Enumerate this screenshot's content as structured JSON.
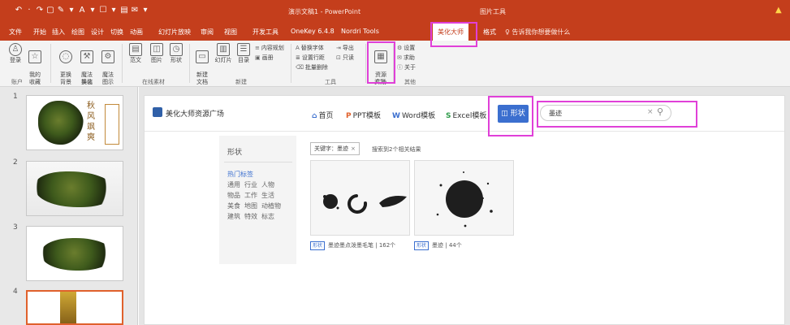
{
  "titlebar": {
    "doc_title": "演示文稿1 - PowerPoint",
    "context_title": "图片工具",
    "qat": [
      "↶",
      "·",
      "↷",
      "▢",
      "✎",
      "▾",
      "A",
      "▾",
      "☐",
      "▾",
      "▤",
      "✉",
      "▾"
    ]
  },
  "tabs": {
    "items": [
      {
        "label": "文件"
      },
      {
        "label": "开始"
      },
      {
        "label": "插入"
      },
      {
        "label": "绘图"
      },
      {
        "label": "设计"
      },
      {
        "label": "切换"
      },
      {
        "label": "动画"
      },
      {
        "label": "幻灯片放映"
      },
      {
        "label": "审阅"
      },
      {
        "label": "视图"
      },
      {
        "label": "开发工具"
      },
      {
        "label": "OneKey 6.4.8"
      },
      {
        "label": "Nordri Tools"
      },
      {
        "label": "美化大师"
      },
      {
        "label": "格式"
      }
    ],
    "search": "告诉我你想要做什么",
    "search_icon": "♀"
  },
  "ribbon": {
    "buttons": [
      {
        "label": "登录",
        "icon": "♙"
      },
      {
        "label": "我的\n收藏",
        "icon": "☆"
      },
      {
        "label": "更换\n背景",
        "icon": "◌"
      },
      {
        "label": "魔法\n换装",
        "icon": "⚒"
      },
      {
        "label": "魔法\n图示",
        "icon": "⚙"
      },
      {
        "label": "范文",
        "icon": "▤"
      },
      {
        "label": "图片",
        "icon": "◫"
      },
      {
        "label": "形状",
        "icon": "◷"
      },
      {
        "label": "新建\n文档",
        "icon": "▭"
      },
      {
        "label": "幻灯片",
        "icon": "▥"
      },
      {
        "label": "目录",
        "icon": "☰"
      },
      {
        "label": "资源\n广场",
        "icon": "▦"
      }
    ],
    "small": {
      "content_plan": "内容规划",
      "gallery": "画册",
      "replace_font": "替换字体",
      "export": "导出",
      "line_spacing": "设置行距",
      "read_only": "只读",
      "batch_delete": "批量删除",
      "settings": "设置",
      "help": "求助",
      "about": "关于"
    },
    "groups": [
      "账户",
      "美化",
      "在线素材",
      "新建",
      "工具",
      "资源",
      "其他"
    ]
  },
  "slides": {
    "numbers": [
      "1",
      "2",
      "3",
      "4"
    ],
    "slide1_text": "秋风飒爽"
  },
  "panel": {
    "title": "美化大师资源广场",
    "nav": [
      {
        "icon": "⌂",
        "label": "首页"
      },
      {
        "icon": "P",
        "label": "PPT模板"
      },
      {
        "icon": "W",
        "label": "Word模板"
      },
      {
        "icon": "S",
        "label": "Excel模板"
      }
    ],
    "active_nav": "形状",
    "active_nav_icon": "◫",
    "search_value": "墨迹",
    "clear_icon": "×",
    "search_icon": "⚲",
    "sidebar": {
      "title": "形状",
      "hot_label": "热门标签",
      "rows": [
        [
          "通用",
          "行业",
          "人物"
        ],
        [
          "物品",
          "工作",
          "生活"
        ],
        [
          "美食",
          "地图",
          "动植物"
        ],
        [
          "建筑",
          "特效",
          "标志"
        ]
      ]
    },
    "filter_chip": "关键字：墨迹",
    "chip_close": "×",
    "result_count": "搜索到2个相关结果",
    "results": [
      {
        "tag": "形状",
        "caption": "墨迹墨点泼墨毛笔 | 162个"
      },
      {
        "tag": "形状",
        "caption": "墨迹 | 44个"
      }
    ]
  },
  "colors": {
    "accent": "#c43e1c",
    "highlight": "#e040d8",
    "nav_active": "#3b6fcf"
  }
}
